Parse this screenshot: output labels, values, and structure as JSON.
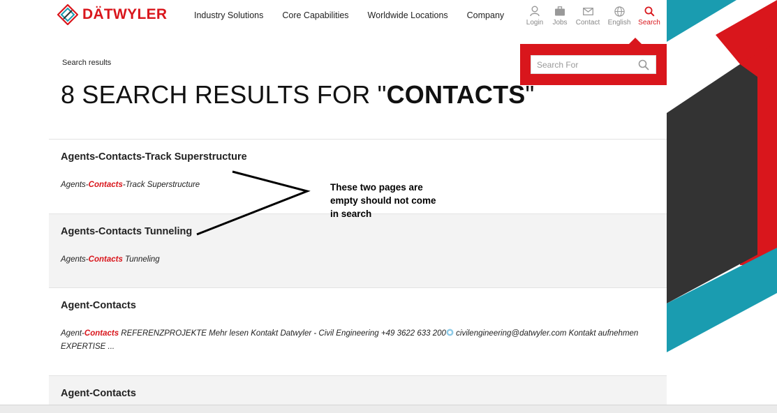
{
  "brand": {
    "name": "DÄTWYLER",
    "color": "#d9161c"
  },
  "nav": [
    {
      "label": "Industry Solutions"
    },
    {
      "label": "Core Capabilities"
    },
    {
      "label": "Worldwide Locations"
    },
    {
      "label": "Company"
    }
  ],
  "tools": [
    {
      "label": "Login",
      "icon": "user-icon"
    },
    {
      "label": "Jobs",
      "icon": "briefcase-icon"
    },
    {
      "label": "Contact",
      "icon": "envelope-icon"
    },
    {
      "label": "English",
      "icon": "globe-icon"
    },
    {
      "label": "Search",
      "icon": "search-icon",
      "active": true
    }
  ],
  "search": {
    "placeholder": "Search For",
    "value": ""
  },
  "breadcrumb": "Search results",
  "page_title": {
    "prefix": "8 SEARCH RESULTS FOR \"",
    "query": "CONTACTS",
    "suffix": "\""
  },
  "results": [
    {
      "title": "Agents-Contacts-Track Superstructure",
      "pre": "Agents-",
      "hl": "Contacts",
      "post": "-Track Superstructure"
    },
    {
      "title": "Agents-Contacts Tunneling",
      "pre": "Agents-",
      "hl": "Contacts",
      "post": " Tunneling"
    },
    {
      "title": "Agent-Contacts",
      "pre": "Agent-",
      "hl": "Contacts",
      "post": " REFERENZPROJEKTE Mehr lesen Kontakt Datwyler - Civil Engineering +49 3622 633 200",
      "post2": " civilengineering@datwyler.com Kontakt aufnehmen EXPERTISE ..."
    },
    {
      "title": "Agent-Contacts"
    }
  ],
  "annotation": "These two pages are empty should not come in search",
  "colors": {
    "teal": "#1a9cb0",
    "dark": "#333333",
    "red": "#d9161c"
  }
}
